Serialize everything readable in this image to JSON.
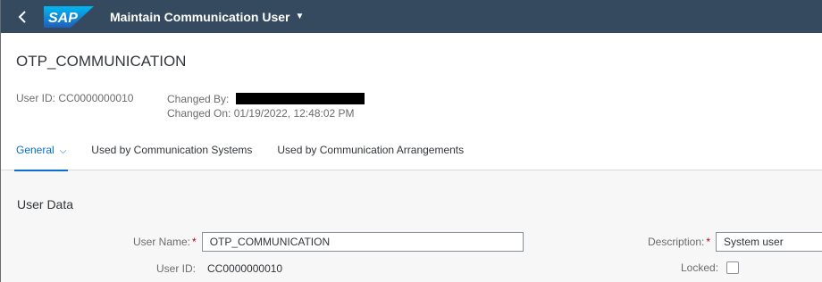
{
  "shellbar": {
    "logo": "SAP",
    "app_title": "Maintain Communication User",
    "title_caret": "▼"
  },
  "header": {
    "object_title": "OTP_COMMUNICATION",
    "user_id_label": "User ID:",
    "user_id_value": "CC0000000010",
    "changed_by_label": "Changed By:",
    "changed_on_label": "Changed On:",
    "changed_on_value": "01/19/2022, 12:48:02 PM"
  },
  "tabs": [
    {
      "label": "General",
      "active": true
    },
    {
      "label": "Used by Communication Systems",
      "active": false
    },
    {
      "label": "Used by Communication Arrangements",
      "active": false
    }
  ],
  "section": {
    "title": "User Data"
  },
  "form": {
    "user_name_label": "User Name:",
    "user_name_value": "OTP_COMMUNICATION",
    "user_id_label": "User ID:",
    "user_id_value": "CC0000000010",
    "description_label": "Description:",
    "description_value": "System user",
    "locked_label": "Locked:",
    "required_marker": "*"
  },
  "colors": {
    "shellbar": "#354a5f",
    "accent": "#0a6ed1",
    "required": "#bb0000"
  }
}
